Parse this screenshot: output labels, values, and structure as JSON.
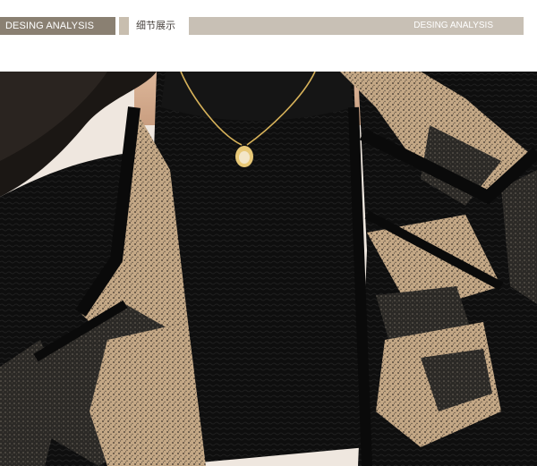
{
  "header": {
    "left_tag": "DESING ANALYSIS",
    "center_label": "细节展示",
    "right_tag": "DESING ANALYSIS"
  },
  "colors": {
    "left_tag_bg": "#8a8072",
    "right_tag_bg": "#c8c0b5",
    "accent_strip": "#c8beaf",
    "fabric_black": "#111111",
    "fabric_beige": "#c9ad8c"
  }
}
